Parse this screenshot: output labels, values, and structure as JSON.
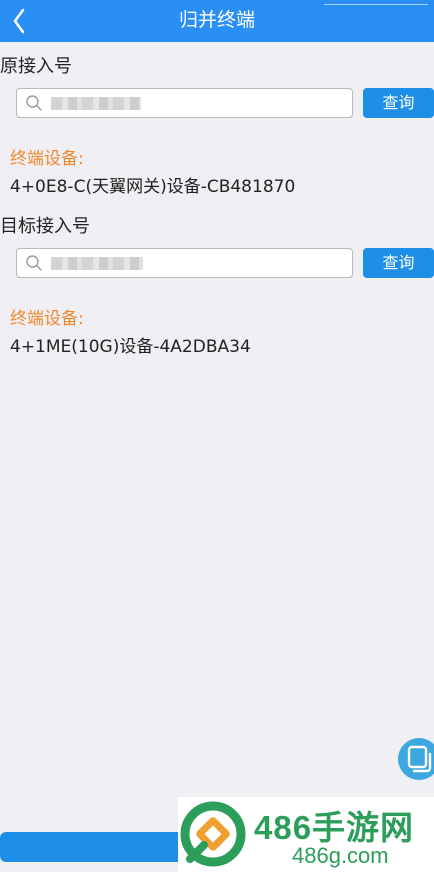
{
  "header": {
    "title": "归并终端"
  },
  "original": {
    "label": "原接入号",
    "query_label": "查询",
    "terminal_label": "终端设备:",
    "terminal_value": "4+0E8-C(天翼网关)设备-CB481870"
  },
  "target": {
    "label": "目标接入号",
    "query_label": "查询",
    "terminal_label": "终端设备:",
    "terminal_value": "4+1ME(10G)设备-4A2DBA34"
  },
  "watermark": {
    "title": "486手游网",
    "subtitle": "486g.com"
  },
  "colors": {
    "header": "#2a8ff5",
    "button": "#1e8fe8",
    "terminal_label": "#f0882a",
    "watermark": "#2c9e5a"
  }
}
